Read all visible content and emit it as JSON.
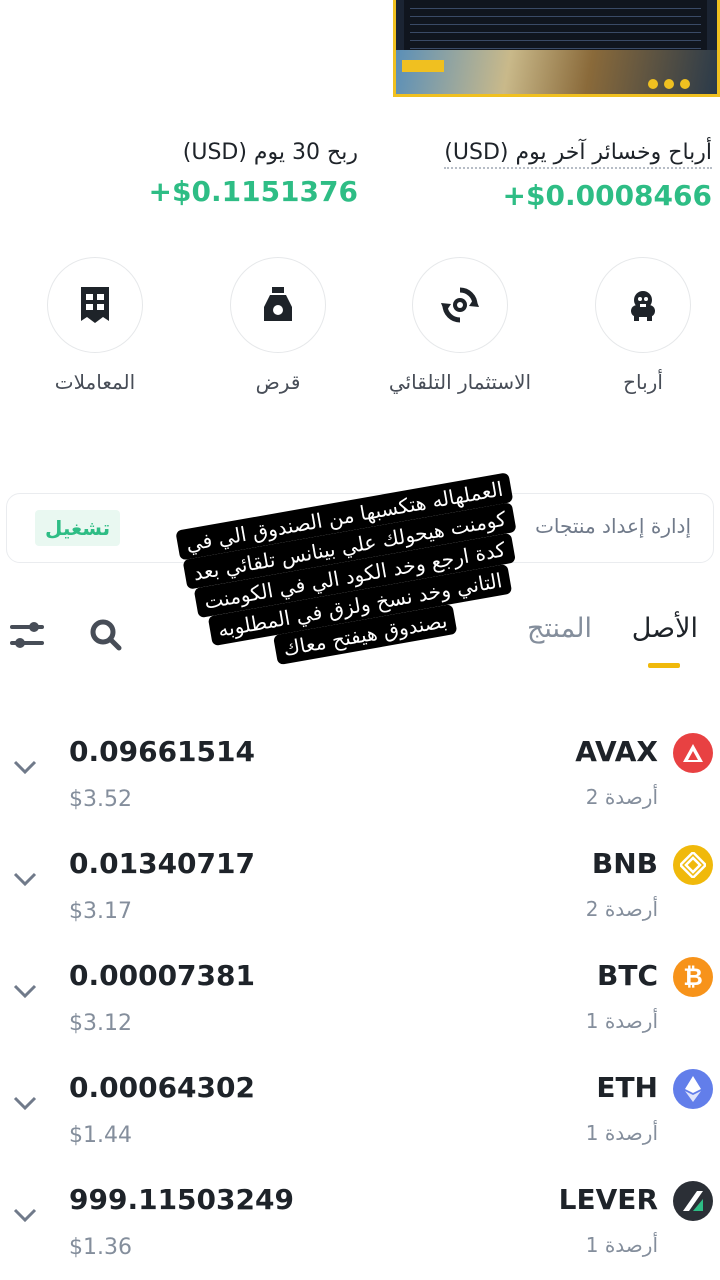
{
  "stats": {
    "day": {
      "label": "أرباح وخسائر آخر يوم (USD)",
      "value": "+$0.0008466"
    },
    "month": {
      "label": "ربح 30 يوم (USD)",
      "value": "+$0.1151376"
    }
  },
  "actions": [
    {
      "label": "أرباح",
      "icon": "piggy-bank-icon"
    },
    {
      "label": "الاستثمار التلقائي",
      "icon": "auto-invest-icon"
    },
    {
      "label": "قرض",
      "icon": "loan-bag-icon"
    },
    {
      "label": "المعاملات",
      "icon": "transactions-icon"
    }
  ],
  "banner": {
    "text": "إدارة إعداد منتجات",
    "button": "تشغيل"
  },
  "tabs": {
    "active": "الأصل",
    "inactive": "المنتج"
  },
  "overlay": {
    "lines": [
      "العملهاله هتكسبها من الصندوق الي في",
      "كومنت هيحولك علي بينانس تلقائي بعد",
      "كدة ارجع وخد الكود الي في الكومنت",
      "التاني وخد نسخ ولزق في المطلوبه",
      "بصندوق هيفتح معاك"
    ]
  },
  "assets": [
    {
      "symbol": "AVAX",
      "balances": "أرصدة 2",
      "amount": "0.09661514",
      "usd": "$3.52",
      "color": "#e84142"
    },
    {
      "symbol": "BNB",
      "balances": "أرصدة 2",
      "amount": "0.01340717",
      "usd": "$3.17",
      "color": "#f0b90b"
    },
    {
      "symbol": "BTC",
      "balances": "أرصدة 1",
      "amount": "0.00007381",
      "usd": "$3.12",
      "color": "#f7931a"
    },
    {
      "symbol": "ETH",
      "balances": "أرصدة 1",
      "amount": "0.00064302",
      "usd": "$1.44",
      "color": "#627eea"
    },
    {
      "symbol": "LEVER",
      "balances": "أرصدة 1",
      "amount": "999.11503249",
      "usd": "$1.36",
      "color": "#2b2f36"
    }
  ]
}
